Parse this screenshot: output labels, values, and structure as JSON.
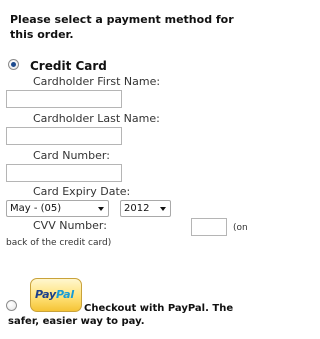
{
  "heading": "Please select a payment method for this order.",
  "credit_card": {
    "label": "Credit Card",
    "selected": true,
    "first_name": {
      "label": "Cardholder First Name:",
      "value": ""
    },
    "last_name": {
      "label": "Cardholder Last Name:",
      "value": ""
    },
    "card_number": {
      "label": "Card Number:",
      "value": ""
    },
    "expiry": {
      "label": "Card Expiry Date:",
      "month": "May - (05)",
      "year": "2012"
    },
    "cvv": {
      "label": "CVV Number:",
      "value": "",
      "note_start": "(on",
      "note_end": "back of the credit card)"
    }
  },
  "paypal": {
    "selected": false,
    "logo_text_pay": "Pay",
    "logo_text_pal": "Pal",
    "description": "Checkout with PayPal. The safer, easier way to pay."
  }
}
